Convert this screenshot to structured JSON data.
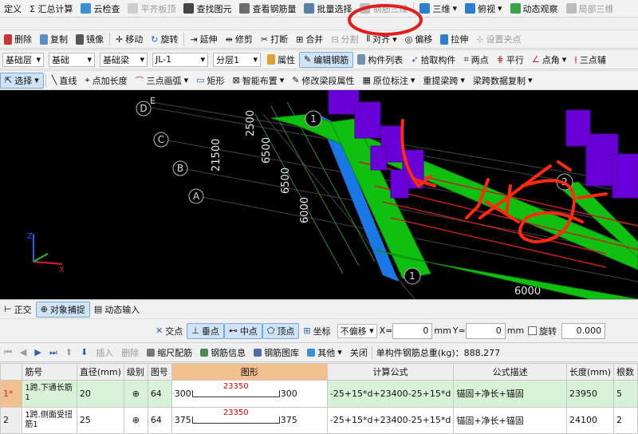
{
  "toolbar1": {
    "items": [
      "定义",
      "Σ 汇总计算",
      "云检查",
      "平齐板顶",
      "查找图元",
      "查看钢筋量",
      "批量选择",
      "钢筋三维",
      "三维",
      "俯视",
      "动态观察",
      "局部三维"
    ]
  },
  "toolbar2": {
    "items": [
      "删除",
      "复制",
      "镜像",
      "移动",
      "旋转",
      "延伸",
      "修剪",
      "打断",
      "合并",
      "分割",
      "对齐",
      "偏移",
      "拉伸",
      "设置夹点"
    ]
  },
  "toolbar3": {
    "floor": "基础层",
    "cat": "基础",
    "type": "基础梁",
    "code": "JL-1",
    "layer": "分层1",
    "items": [
      "属性",
      "编辑钢筋",
      "构件列表",
      "拾取构件",
      "两点",
      "平行",
      "点角",
      "三点辅"
    ]
  },
  "toolbar4": {
    "items": [
      "选择",
      "直线",
      "点加长度",
      "三点画弧",
      "矩形",
      "智能布置",
      "修改梁段属性",
      "原位标注",
      "重提梁跨",
      "梁跨数据复制"
    ]
  },
  "viewport": {
    "axes": [
      "D",
      "E",
      "C",
      "B",
      "A"
    ],
    "dims": [
      "2500",
      "21500",
      "6500",
      "6500",
      "6000",
      "6000",
      "1"
    ],
    "markers": [
      "1",
      "1",
      "2"
    ],
    "handwriting": "卡死",
    "colors": {
      "beam": "#10c010",
      "column": "#6a00d8",
      "side": "#1a78e6",
      "rebar": "#c02020",
      "grid": "#3a3a3a"
    }
  },
  "snap": {
    "items": [
      "正交",
      "对象捕捉",
      "动态输入"
    ]
  },
  "snap2": {
    "items": [
      "交点",
      "垂点",
      "中点",
      "顶点",
      "坐标",
      "不偏移"
    ],
    "x_label": "X=",
    "x": "0",
    "mm1": "mm",
    "y_label": "Y=",
    "y": "0",
    "mm2": "mm",
    "rotate_label": "旋转",
    "rotate": "0.000"
  },
  "rebar_bar": {
    "items": [
      "插入",
      "删除",
      "缩尺配筋",
      "钢筋信息",
      "钢筋图库",
      "其他",
      "关闭"
    ],
    "total": "单构件钢筋总重(kg)：888.277"
  },
  "table": {
    "headers": [
      "",
      "筋号",
      "直径(mm)",
      "级别",
      "图号",
      "图形",
      "计算公式",
      "公式描述",
      "长度(mm)",
      "根数"
    ],
    "rows": [
      {
        "idx": "1*",
        "name": "1跨.下通长筋1",
        "dia": "20",
        "grade": "⊕",
        "fig": "64",
        "left": "300",
        "mid": "23350",
        "right": "300",
        "formula": "-25+15*d+23400-25+15*d",
        "desc": "锚固+净长+锚固",
        "len": "23950",
        "count": "5"
      },
      {
        "idx": "2",
        "name": "1跨.侧面受扭筋1",
        "dia": "25",
        "grade": "⊕",
        "fig": "64",
        "left": "375",
        "mid": "23350",
        "right": "375",
        "formula": "-25+15*d+23400-25+15*d",
        "desc": "锚固+净长+锚固",
        "len": "24100",
        "count": "2"
      }
    ]
  }
}
